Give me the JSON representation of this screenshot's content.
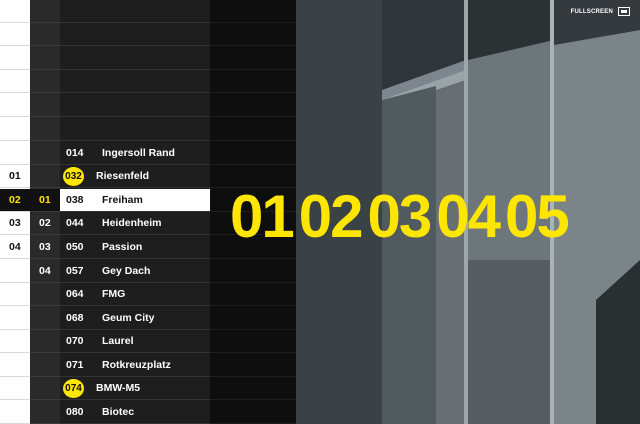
{
  "col1": {
    "items": [
      "01",
      "02",
      "03",
      "04"
    ]
  },
  "col2": {
    "items": [
      "01",
      "02",
      "03",
      "04"
    ]
  },
  "list": {
    "items": [
      {
        "num": "014",
        "label": "Ingersoll Rand",
        "badge": false
      },
      {
        "num": "032",
        "label": "Riesenfeld",
        "badge": true
      },
      {
        "num": "038",
        "label": "Freiham",
        "badge": false
      },
      {
        "num": "044",
        "label": "Heidenheim",
        "badge": false
      },
      {
        "num": "050",
        "label": "Passion",
        "badge": false
      },
      {
        "num": "057",
        "label": "Gey Dach",
        "badge": false
      },
      {
        "num": "064",
        "label": "FMG",
        "badge": false
      },
      {
        "num": "068",
        "label": "Geum City",
        "badge": false
      },
      {
        "num": "070",
        "label": "Laurel",
        "badge": false
      },
      {
        "num": "071",
        "label": "Rotkreuzplatz",
        "badge": false
      },
      {
        "num": "074",
        "label": "BMW-M5",
        "badge": true
      },
      {
        "num": "080",
        "label": "Biotec",
        "badge": false
      }
    ]
  },
  "gallery": {
    "numbers": [
      "01",
      "02",
      "03",
      "04",
      "05"
    ]
  },
  "fullscreen": {
    "label": "FULLSCREEN",
    "icon": "fullscreen-icon"
  },
  "colors": {
    "accent": "#ffe600",
    "background": "#111111"
  }
}
